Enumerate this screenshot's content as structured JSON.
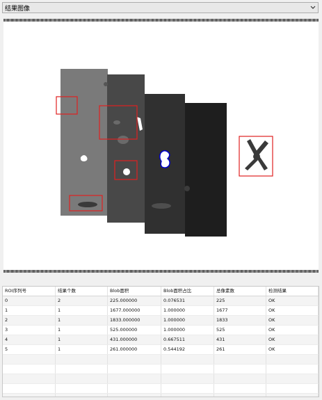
{
  "result_selector": {
    "value": "结果图像",
    "icon": "chevron-down-icon"
  },
  "viewer": {
    "background": "#ffffff",
    "roi_color": "#e02020",
    "blob_outline_color": "#0000cc"
  },
  "table": {
    "headers": [
      "ROI序列号",
      "结果个数",
      "Blob面积",
      "Blob面积占比",
      "总像素数",
      "检测结果"
    ],
    "rows": [
      [
        "0",
        "2",
        "225.000000",
        "0.076531",
        "225",
        "OK"
      ],
      [
        "1",
        "1",
        "1677.000000",
        "1.000000",
        "1677",
        "OK"
      ],
      [
        "2",
        "1",
        "1833.000000",
        "1.000000",
        "1833",
        "OK"
      ],
      [
        "3",
        "1",
        "525.000000",
        "1.000000",
        "525",
        "OK"
      ],
      [
        "4",
        "1",
        "431.000000",
        "0.667511",
        "431",
        "OK"
      ],
      [
        "5",
        "1",
        "261.000000",
        "0.544192",
        "261",
        "OK"
      ]
    ],
    "empty_rows": 5
  }
}
